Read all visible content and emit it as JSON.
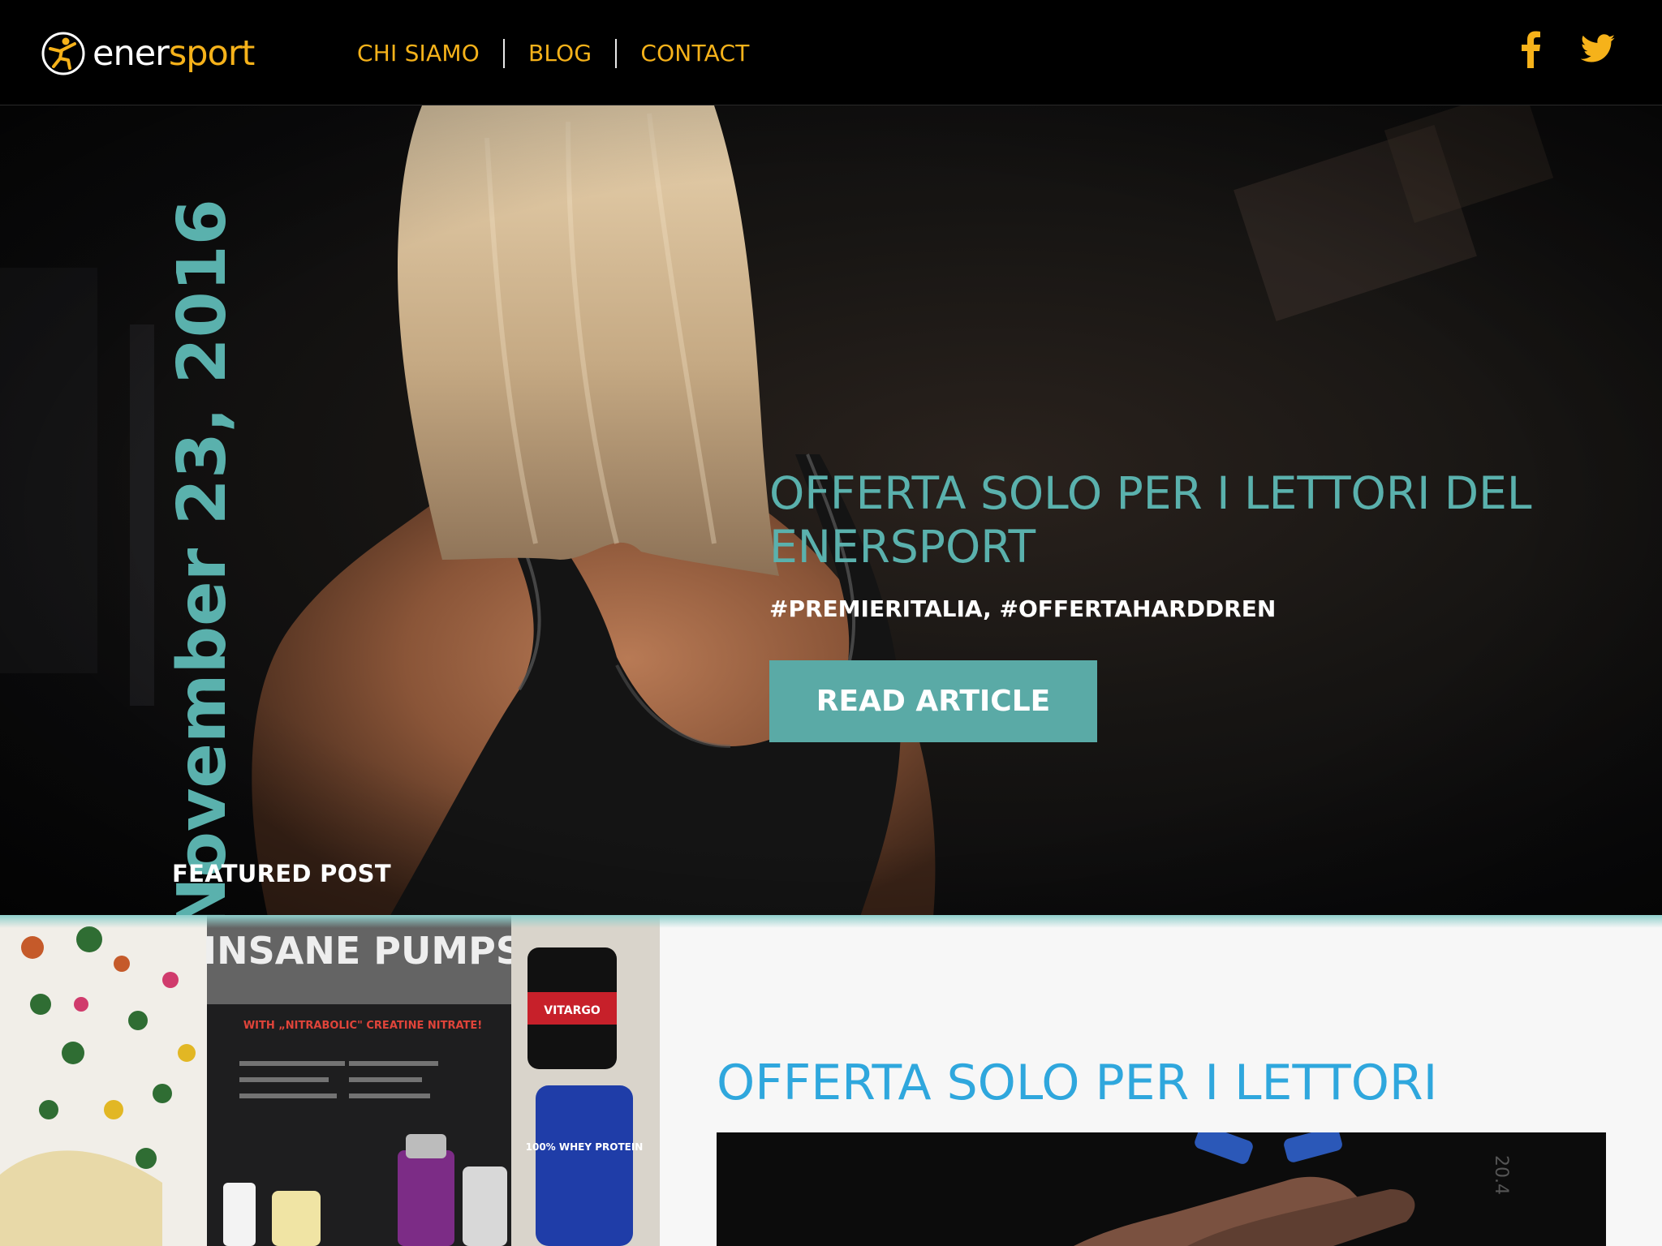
{
  "brand": {
    "logo_white": "ener",
    "logo_yellow": "sport",
    "colors": {
      "yellow": "#f6b21a",
      "teal": "#5ab1ad",
      "blue": "#2fa7dd",
      "black": "#000000"
    }
  },
  "nav": {
    "items": [
      {
        "label": "CHI SIAMO"
      },
      {
        "label": "BLOG"
      },
      {
        "label": "CONTACT"
      }
    ]
  },
  "social": {
    "icons": [
      "facebook-icon",
      "twitter-icon"
    ]
  },
  "hero": {
    "date": "November 23, 2016",
    "featured_label": "FEATURED POST",
    "title": "OFFERTA SOLO PER I LETTORI DEL ENERSPORT",
    "tags": "#PREMIERITALIA, #OFFERTAHARDDREN",
    "button_label": "READ ARTICLE"
  },
  "second_post": {
    "title": "OFFERTA SOLO PER I LETTORI",
    "image_label": "20.4"
  },
  "supplement_image": {
    "banner_title": "INSANE PUMPS",
    "banner_subtitle": "WITH „NITRABOLIC\" CREATINE NITRATE!",
    "tub_label": "VITARGO",
    "whey_label": "100% WHEY PROTEIN"
  }
}
